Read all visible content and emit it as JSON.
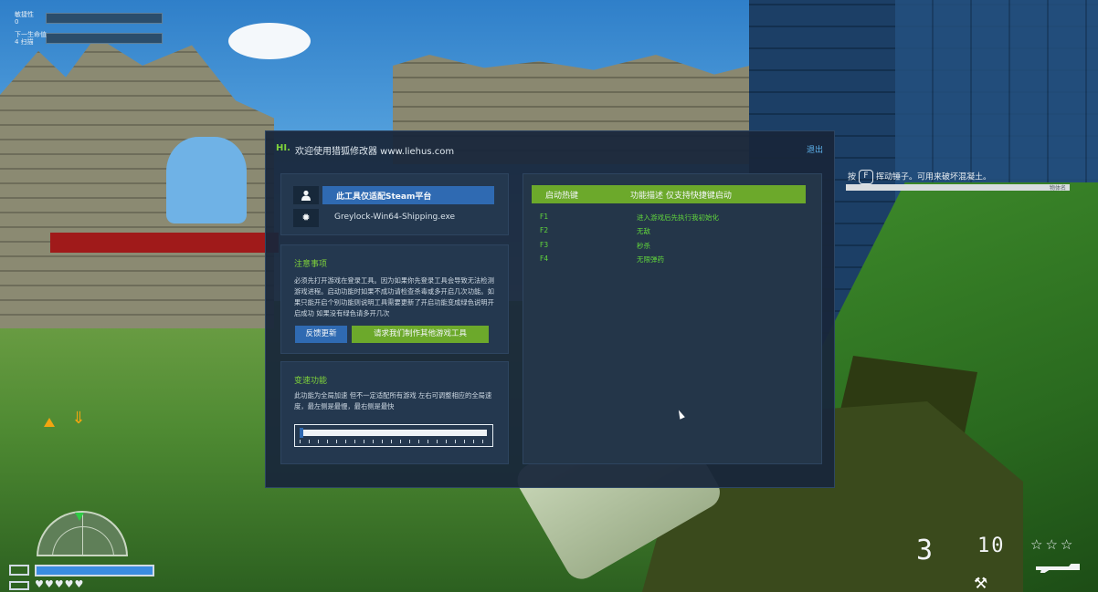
{
  "hud": {
    "bar1_label": "敏捷性",
    "bar1_value": "0",
    "bar2_label": "下一生命值",
    "bar2_value": "4 扫描",
    "ammo_clip": "3",
    "ammo_reserve": "10",
    "rating_stars": "☆☆☆",
    "hearts": "♥♥♥♥♥",
    "health_level": 1.0
  },
  "prompt": {
    "prefix": "按",
    "key": "F",
    "text": "挥动锤子。可用来破坏混凝土。",
    "bar_label": "物体名"
  },
  "trainer": {
    "hi": "HI.",
    "title": "欢迎使用猎狐修改器 www.liehus.com",
    "exit": "退出",
    "platform": "此工具仅适配Steam平台",
    "exe": "Greylock-Win64-Shipping.exe",
    "notice": {
      "title": "注意事项",
      "text": "必须先打开游戏在登录工具。因为如果你先登录工具会导致无法检测游戏进程。启动功能时如果不成功请检查杀毒或多开启几次功能。如果只能开启个别功能则说明工具需要更新了开启功能变成绿色说明开启成功 如果没有绿色请多开几次",
      "feedback_button": "反馈更新",
      "request_button": "请求我们制作其他游戏工具"
    },
    "speed": {
      "title": "变速功能",
      "text": "此功能为全局加速 但不一定适配所有游戏 左右可调整相应的全局速度，最左侧是最慢，最右侧是最快",
      "level": 0.0
    },
    "hotkeys": {
      "col_key": "启动热键",
      "col_desc": "功能描述 仅支持快捷键启动",
      "rows": [
        {
          "key": "F1",
          "desc": "进入游戏后先执行我初始化"
        },
        {
          "key": "F2",
          "desc": "无敌"
        },
        {
          "key": "F3",
          "desc": "秒杀"
        },
        {
          "key": "F4",
          "desc": "无限弹药"
        }
      ]
    }
  },
  "icons": {
    "user": "user-icon",
    "gear": "gear-icon"
  },
  "colors": {
    "accent_blue": "#2f6ab2",
    "accent_green": "#6ca92b",
    "panel_bg": "#18263a",
    "hotkey_text": "#62d83c"
  }
}
